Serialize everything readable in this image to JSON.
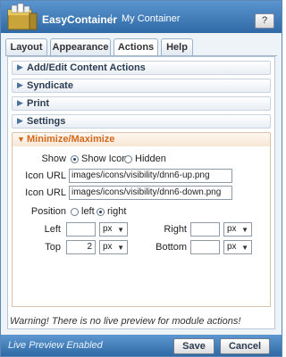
{
  "window": {
    "title": "EasyContainer",
    "separator": "|",
    "subtitle": "My Container",
    "help_label": "?"
  },
  "tabs": [
    {
      "label": "Layout",
      "active": false
    },
    {
      "label": "Appearance",
      "active": false
    },
    {
      "label": "Actions",
      "active": true
    },
    {
      "label": "Help",
      "active": false
    }
  ],
  "sections": {
    "add_edit": "Add/Edit Content Actions",
    "syndicate": "Syndicate",
    "print": "Print",
    "settings": "Settings",
    "minmax": "Minimize/Maximize"
  },
  "minmax": {
    "show_label": "Show",
    "show_icon_label": "Show Icon",
    "hidden_label": "Hidden",
    "show_selected": "Show Icon",
    "icon_url_label": "Icon URL",
    "icon_url_1": "images/icons/visibility/dnn6-up.png",
    "icon_url_2": "images/icons/visibility/dnn6-down.png",
    "position_label": "Position",
    "left_radio_label": "left",
    "right_radio_label": "right",
    "position_selected": "right",
    "left_label": "Left",
    "right_label": "Right",
    "top_label": "Top",
    "bottom_label": "Bottom",
    "left_value": "",
    "right_value": "",
    "top_value": "2",
    "bottom_value": "",
    "unit_left": "px",
    "unit_right": "px",
    "unit_top": "px",
    "unit_bottom": "px"
  },
  "warning": "Warning! There is no live preview for module actions!",
  "footer": {
    "status": "Live Preview Enabled",
    "save_label": "Save",
    "cancel_label": "Cancel"
  },
  "colors": {
    "title_bar": "#2f6aa6",
    "open_section_label": "#d2691e"
  }
}
